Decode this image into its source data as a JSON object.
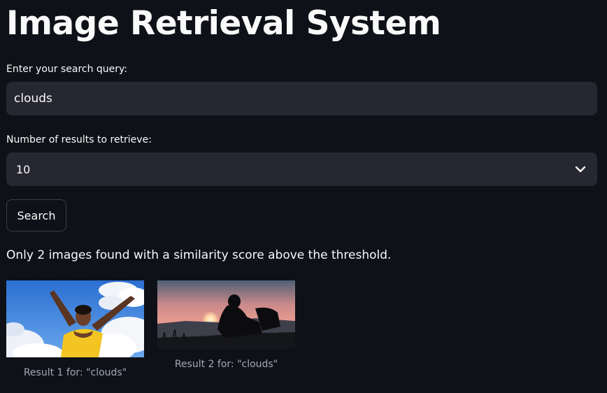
{
  "page": {
    "title": "Image Retrieval System"
  },
  "query": {
    "label": "Enter your search query:",
    "value": "clouds"
  },
  "count": {
    "label": "Number of results to retrieve:",
    "selected": "10"
  },
  "search_button": {
    "label": "Search"
  },
  "status": {
    "message": "Only 2 images found with a similarity score above the threshold."
  },
  "results": [
    {
      "caption": "Result 1 for: \"clouds\""
    },
    {
      "caption": "Result 2 for: \"clouds\""
    }
  ],
  "colors": {
    "background": "#0e1117",
    "field": "#262730",
    "text": "#fafafa",
    "caption": "#a3a8b8"
  },
  "icons": {
    "select_chevron": "chevron-down-icon"
  }
}
